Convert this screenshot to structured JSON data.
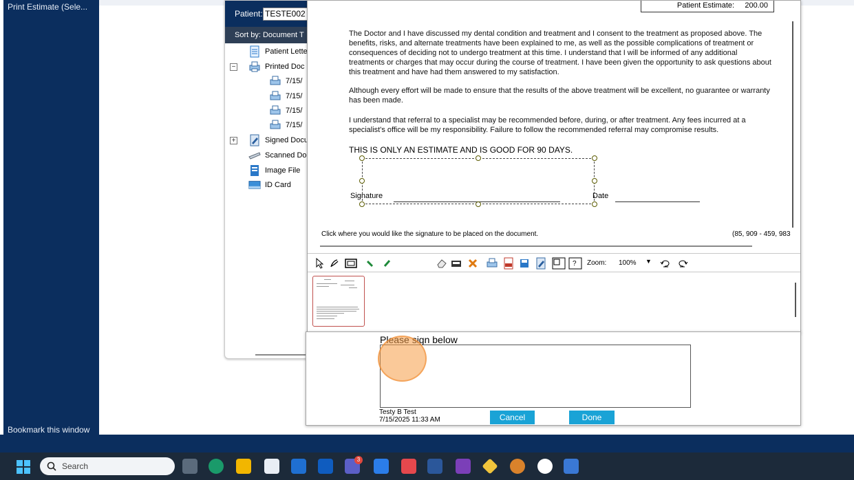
{
  "left_nav": {
    "top_item": "Print Estimate (Sele...",
    "bookmark": "Bookmark this window"
  },
  "doc_manager": {
    "patient_label": "Patient:",
    "patient_value": "TESTE002",
    "sort_label": "Sort by: Document T",
    "tree": {
      "patient_letters": "Patient Lette",
      "printed_docs": "Printed Doc",
      "printed_items": [
        "7/15/",
        "7/15/",
        "7/15/",
        "7/15/"
      ],
      "signed_docs": "Signed Docu",
      "scanned_docs": "Scanned Do",
      "image_file": "Image File",
      "id_card": "ID Card"
    },
    "expanded_symbol": "−",
    "collapsed_symbol": "+"
  },
  "document": {
    "estimate_label": "Patient Estimate:",
    "estimate_value": "200.00",
    "para1": "The Doctor and I have discussed my dental condition and treatment and I consent to the treatment as proposed above.  The benefits, risks, and alternate treatments have been explained to me, as well as the possible complications of treatment or consequences of deciding not to undergo treatment at this time.  I understand that I will be informed of any additional treatments or charges that may occur during the course of treatment.  I have been given the opportunity to ask questions about this treatment and have had them answered to my satisfaction.",
    "para2": "Although every effort will be made to ensure that the results of the above treatment will be excellent, no guarantee or warranty has been made.",
    "para3": "I understand that referral to a specialist may be recommended before, during, or after treatment.  Any fees incurred at a specialist's office will be my responsibility.  Failure to follow the recommended referral may compromise results.",
    "notice": "THIS IS ONLY AN ESTIMATE AND IS GOOD FOR 90 DAYS.",
    "signature_label": "Signature",
    "date_label": "Date"
  },
  "viewer": {
    "status": "Click where you would like the signature to be placed on the document.",
    "coords": "(85, 909 - 459, 983",
    "zoom_label": "Zoom:",
    "zoom_value": "100%",
    "zoom_dropdown": "▼"
  },
  "signature_pad": {
    "prompt": "Please sign below",
    "signer_name": "Testy B Test",
    "signer_time": "7/15/2025 11:33 AM",
    "cancel_label": "Cancel",
    "done_label": "Done"
  },
  "taskbar": {
    "search_label": "Search",
    "teams_badge": "3"
  },
  "colors": {
    "nav_blue": "#0b2e5e",
    "button_blue": "#1aa3d6",
    "cursor_orange": "#f59c46",
    "taskbar": "#1c2a3a"
  }
}
